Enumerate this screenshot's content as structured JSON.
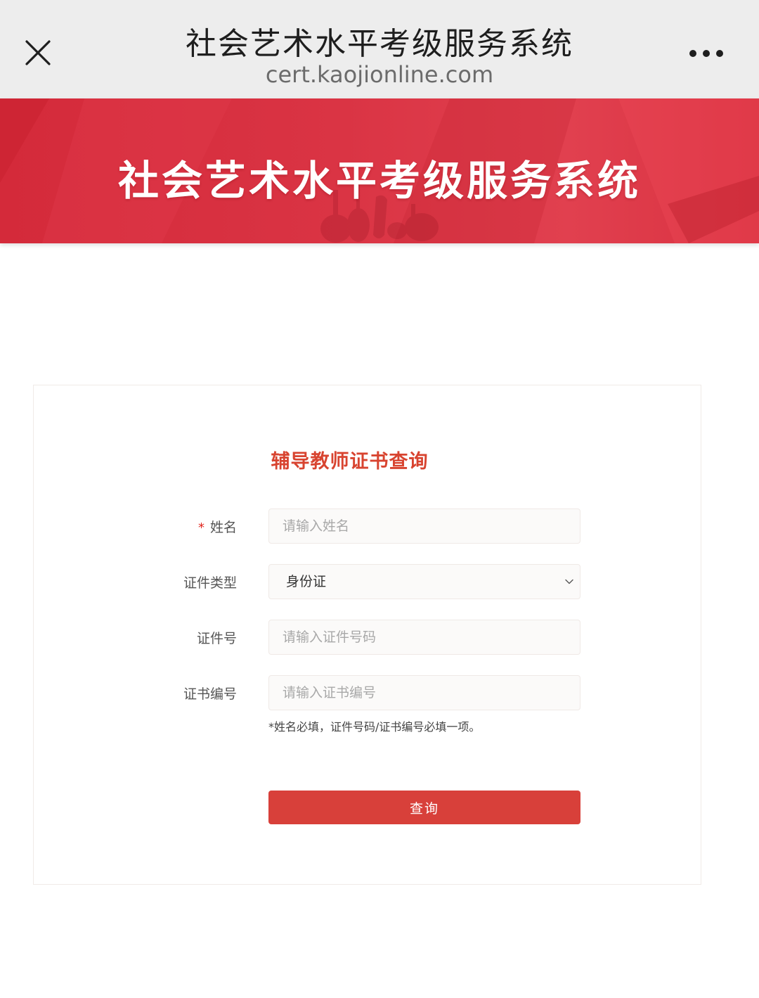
{
  "browser": {
    "title": "社会艺术水平考级服务系统",
    "url": "cert.kaojionline.com",
    "close_icon": "close-icon",
    "more_icon": "more-icon"
  },
  "banner": {
    "title": "社会艺术水平考级服务系统",
    "color": "#d42a3a"
  },
  "form": {
    "title": "辅导教师证书查询",
    "required_mark": "*",
    "fields": [
      {
        "label": "姓名",
        "placeholder": "请输入姓名",
        "required": true
      },
      {
        "label": "证件类型",
        "value": "身份证",
        "type": "select"
      },
      {
        "label": "证件号",
        "placeholder": "请输入证件号码"
      },
      {
        "label": "证书编号",
        "placeholder": "请输入证书编号"
      }
    ],
    "hint": "*姓名必填，证件号码/证书编号必填一项。",
    "submit_label": "查询",
    "accent_color": "#d8403a"
  }
}
